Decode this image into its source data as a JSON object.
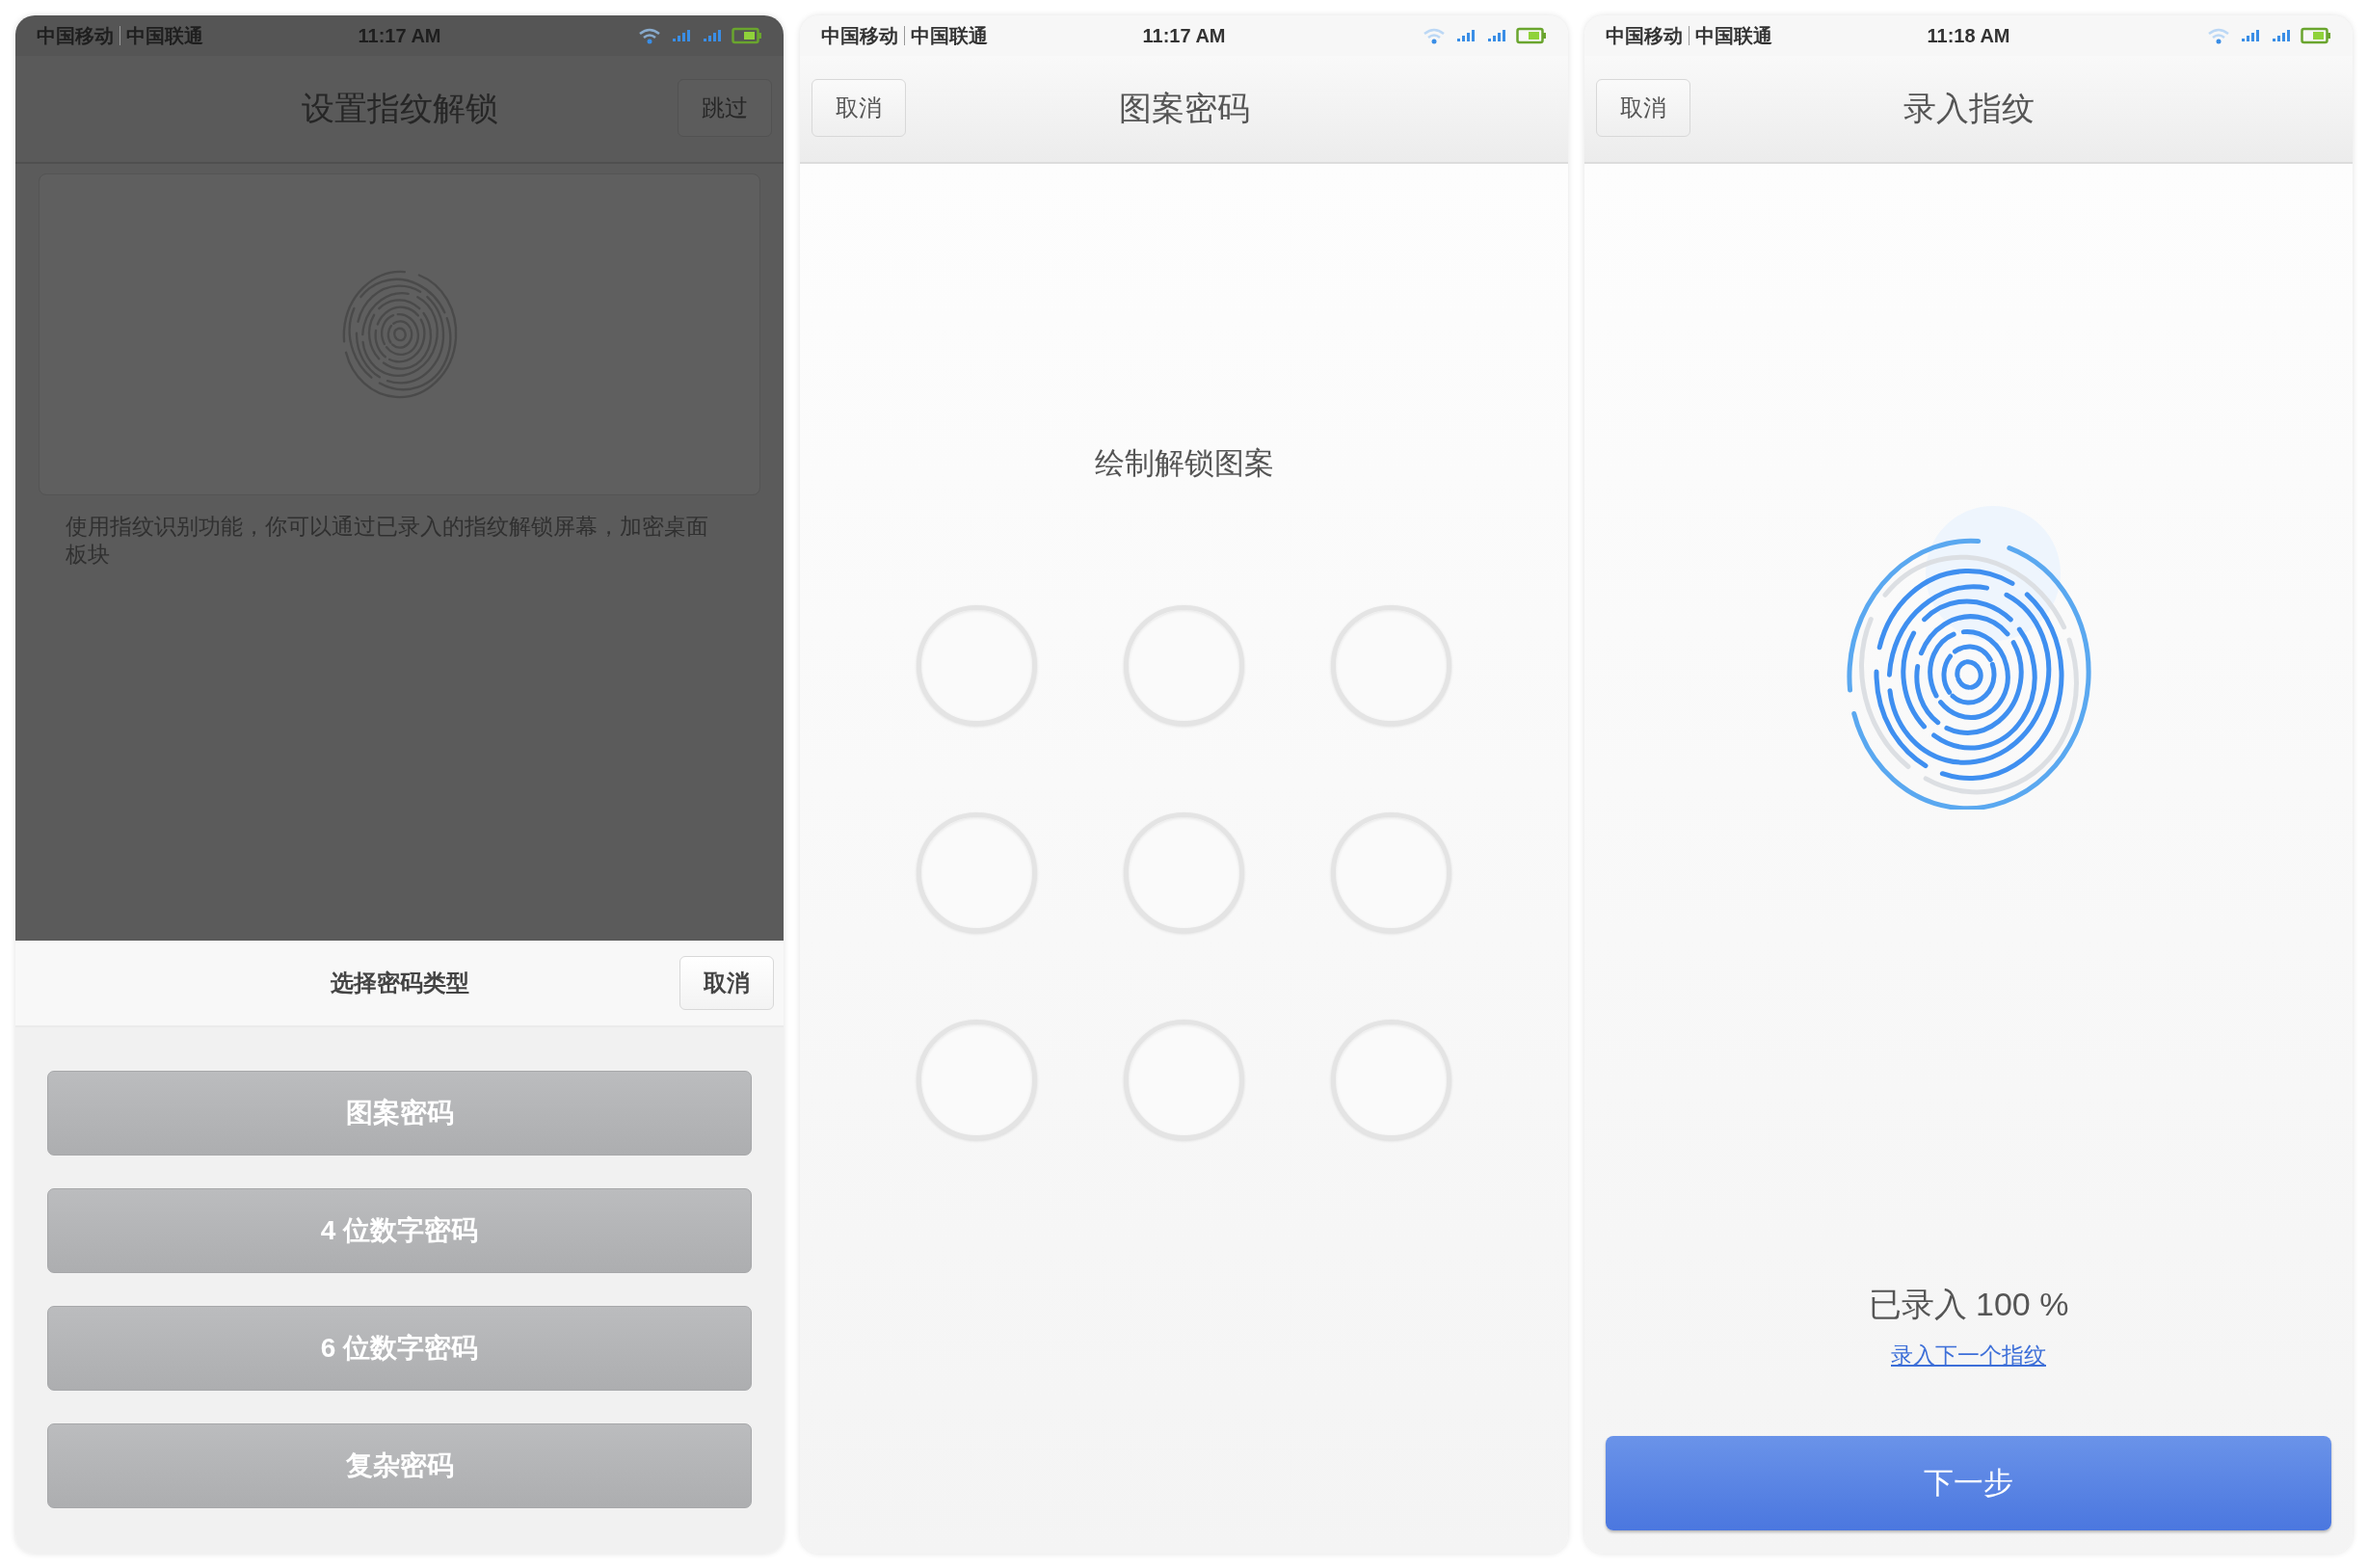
{
  "screens": [
    {
      "kind": "setup",
      "dimmed": true,
      "status_bar": {
        "carriers": [
          "中国移动",
          "中国联通"
        ],
        "time": "11:17 AM"
      },
      "header": {
        "title": "设置指纹解锁",
        "right_button": "跳过"
      },
      "description": "使用指纹识别功能，你可以通过已录入的指纹解锁屏幕，加密桌面板块",
      "sheet": {
        "title": "选择密码类型",
        "cancel": "取消",
        "options": [
          "图案密码",
          "4 位数字密码",
          "6 位数字密码",
          "复杂密码"
        ]
      }
    },
    {
      "kind": "pattern",
      "dimmed": false,
      "status_bar": {
        "carriers": [
          "中国移动",
          "中国联通"
        ],
        "time": "11:17 AM"
      },
      "header": {
        "title": "图案密码",
        "left_button": "取消"
      },
      "prompt": "绘制解锁图案"
    },
    {
      "kind": "enroll",
      "dimmed": false,
      "status_bar": {
        "carriers": [
          "中国移动",
          "中国联通"
        ],
        "time": "11:18 AM"
      },
      "header": {
        "title": "录入指纹",
        "left_button": "取消"
      },
      "progress": "已录入 100 %",
      "link": "录入下一个指纹",
      "next_button": "下一步"
    }
  ]
}
